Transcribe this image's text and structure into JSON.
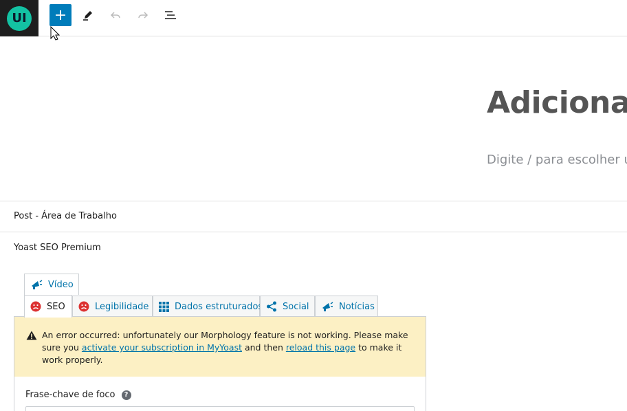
{
  "toolbar": {
    "logo_text": "UI",
    "add_icon": "plus-icon",
    "edit_icon": "pencil-icon",
    "undo_icon": "undo-icon",
    "redo_icon": "redo-icon",
    "outline_icon": "list-view-icon",
    "accent_color": "#007cba"
  },
  "editor": {
    "title": "Adicionar",
    "placeholder": "Digite / para escolher u"
  },
  "panels": {
    "post_area": "Post - Área de Trabalho",
    "yoast": "Yoast SEO Premium"
  },
  "yoast_tabs": {
    "video": "Vídeo",
    "seo": "SEO",
    "legibilidade": "Legibilidade",
    "dados": "Dados estruturados",
    "social": "Social",
    "noticias": "Notícias"
  },
  "notice": {
    "text_before": "An error occurred: unfortunately our Morphology feature is not working. Please make sure you ",
    "link1": "activate your subscription in MyYoast",
    "text_middle": " and then ",
    "link2": "reload this page",
    "text_after": " to make it work properly."
  },
  "focus": {
    "label": "Frase-chave de foco",
    "help_icon": "question-circle-icon",
    "value": ""
  },
  "colors": {
    "link": "#0073aa",
    "notice_bg": "#fcf0c4",
    "error_face": "#dc3232"
  }
}
